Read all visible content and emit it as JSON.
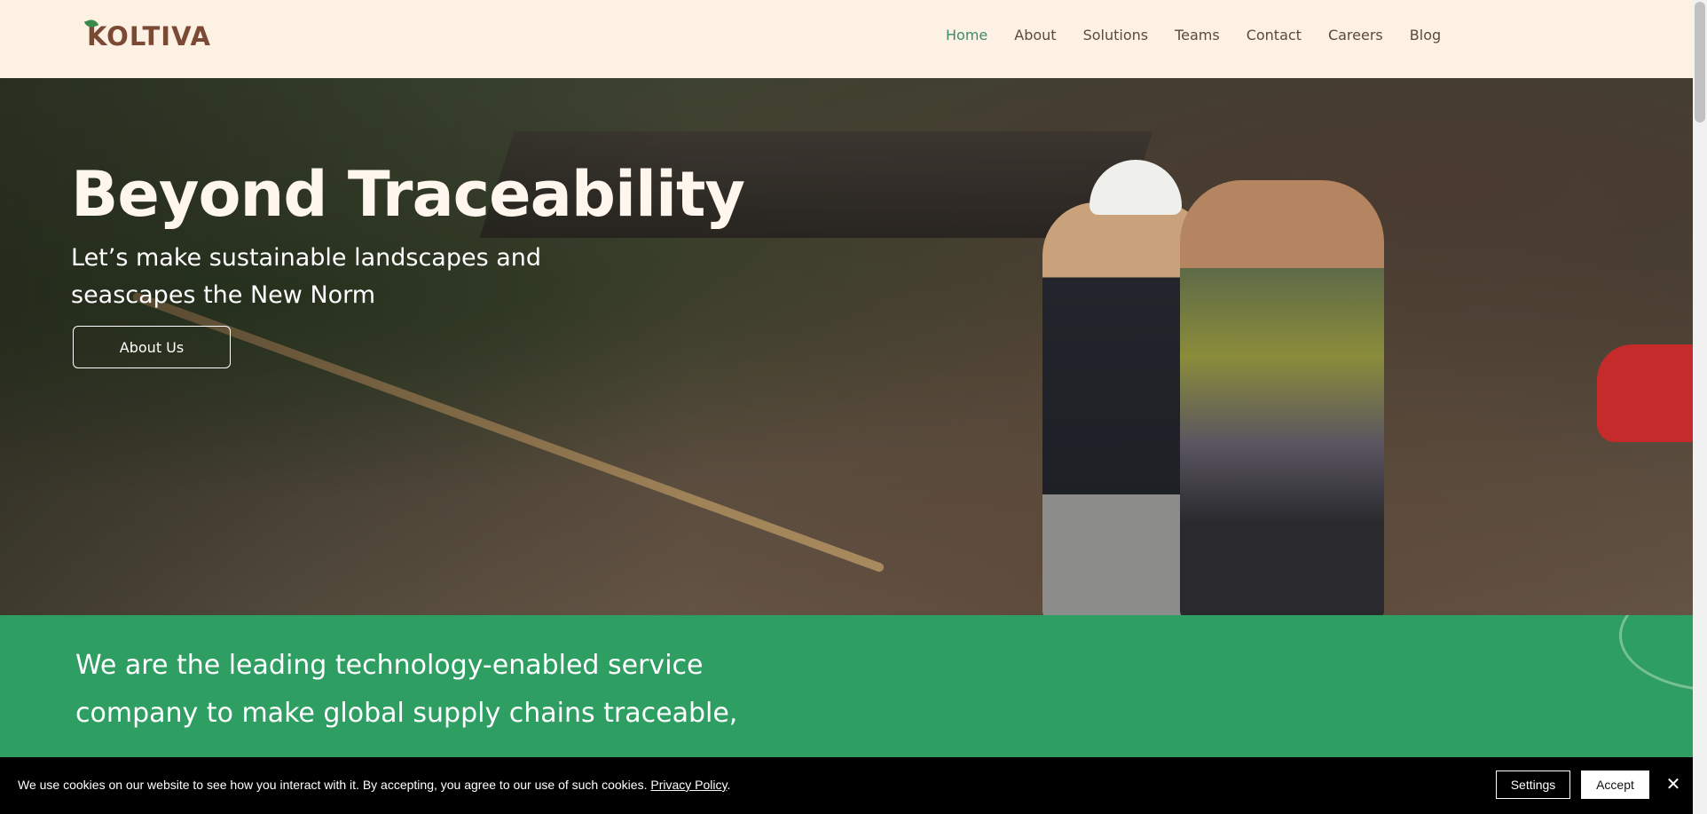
{
  "header": {
    "logo_text": "KOLTIVA",
    "nav": [
      {
        "label": "Home",
        "active": true
      },
      {
        "label": "About"
      },
      {
        "label": "Solutions"
      },
      {
        "label": "Teams"
      },
      {
        "label": "Contact"
      },
      {
        "label": "Careers"
      },
      {
        "label": "Blog"
      }
    ]
  },
  "hero": {
    "title": "Beyond Traceability",
    "subtitle": "Let’s make sustainable landscapes and seascapes the New Norm",
    "button_label": "About Us"
  },
  "intro": {
    "text": "We are the leading technology-enabled service company to make global supply chains traceable,"
  },
  "cookie_banner": {
    "message": "We use cookies on our website to see how you interact with it. By accepting, you agree to our use of such cookies.",
    "privacy_link": "Privacy Policy",
    "period": ".",
    "settings_label": "Settings",
    "accept_label": "Accept",
    "close_glyph": "✕"
  },
  "colors": {
    "header_bg": "#fdf1e3",
    "brand_brown": "#7b4a35",
    "brand_green": "#2e9e62",
    "nav_active": "#3c8c6c"
  }
}
